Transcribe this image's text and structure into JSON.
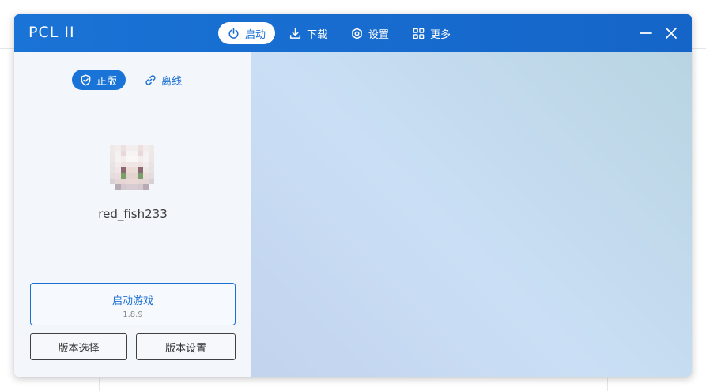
{
  "app": {
    "title": "PCL II"
  },
  "nav": {
    "items": [
      {
        "label": "启动",
        "icon": "power-icon",
        "active": true
      },
      {
        "label": "下载",
        "icon": "download-icon",
        "active": false
      },
      {
        "label": "设置",
        "icon": "gear-icon",
        "active": false
      },
      {
        "label": "更多",
        "icon": "grid-icon",
        "active": false
      }
    ]
  },
  "window_controls": {
    "minimize_icon": "minimize-icon",
    "close_icon": "close-icon"
  },
  "sidebar": {
    "mode": {
      "official_label": "正版",
      "official_icon": "shield-check-icon",
      "offline_label": "离线",
      "offline_icon": "link-icon",
      "selected": "正版"
    },
    "username": "red_fish233",
    "launch": {
      "label": "启动游戏",
      "version": "1.8.9"
    },
    "version_select_label": "版本选择",
    "version_settings_label": "版本设置"
  },
  "colors": {
    "accent": "#1a73d6",
    "titlebar": "#1565c8",
    "sidebar_bg": "#f3f6fb",
    "content_bg": "#c5daf1"
  }
}
